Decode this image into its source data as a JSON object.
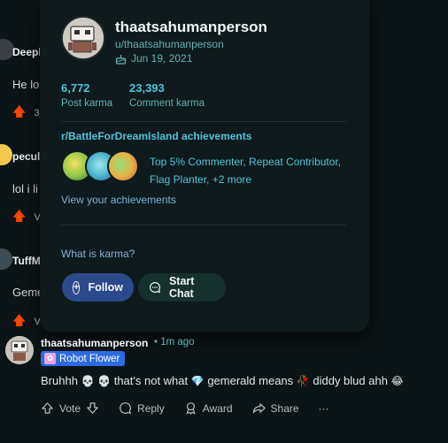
{
  "background_comments": [
    {
      "username": "Deepl",
      "text": "He lo",
      "votes": "3"
    },
    {
      "username": "peculi",
      "text": "lol i li",
      "votes": "V"
    },
    {
      "username": "TuffM",
      "text": "Geme",
      "votes": "V"
    }
  ],
  "profile_card": {
    "display_name": "thaatsahumanperson",
    "handle": "u/thaatsahumanperson",
    "cake_day": "Jun 19, 2021",
    "post_karma": "6,772",
    "post_karma_label": "Post karma",
    "comment_karma": "23,393",
    "comment_karma_label": "Comment karma",
    "achievements_title": "r/BattleForDreamIsland achievements",
    "achievements_text": "Top 5% Commenter, Repeat Contributor, Flag Planter, +2 more",
    "view_achievements": "View your achievements",
    "what_is_karma": "What is karma?",
    "follow_label": "Follow",
    "chat_label": "Start Chat"
  },
  "main_comment": {
    "username": "thaatsahumanperson",
    "time": "• 1m ago",
    "flair": "Robot Flower",
    "body_parts": {
      "p1": "Bruhhh",
      "p2": "that's not what",
      "p3": "gemerald means",
      "p4": "diddy blud ahh"
    },
    "actions": {
      "vote": "Vote",
      "reply": "Reply",
      "award": "Award",
      "share": "Share",
      "more": "···"
    }
  },
  "colors": {
    "background": "#0b1416",
    "card": "#0f1a1c",
    "accent_teal": "#4fc3d8",
    "follow_button": "#2b4a8c",
    "upvote": "#ff4500",
    "flair": "#2c6be0"
  },
  "icons": [
    "cake-icon",
    "plus-icon",
    "chat-icon",
    "upvote-icon",
    "downvote-icon",
    "reply-icon",
    "award-icon",
    "share-icon",
    "more-icon"
  ]
}
